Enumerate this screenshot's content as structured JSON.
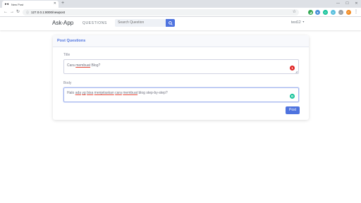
{
  "browser": {
    "tab_title": "New Post",
    "tab_favicon": "▸◂",
    "tab_close": "✕",
    "new_tab": "+",
    "minimize": "—",
    "maximize": "☐",
    "close": "✕",
    "back": "←",
    "forward": "→",
    "reload": "↻",
    "lock": "ⓘ",
    "url": "127.0.0.1:8000/newpost",
    "star": "☆",
    "profile_initial": "F",
    "menu": "⋮",
    "extensions": [
      {
        "icon": "puzzle-green-icon",
        "color": "#34a853",
        "glyph": "◢"
      },
      {
        "icon": "circle-blue-icon",
        "color": "#4a90d9",
        "glyph": "●"
      },
      {
        "icon": "circle-green-icon",
        "color": "#15c39a",
        "glyph": "G"
      },
      {
        "icon": "circle-lightblue-icon",
        "color": "#5bc0de",
        "glyph": "◐"
      },
      {
        "icon": "circle-grey-icon",
        "color": "#9aa0a6",
        "glyph": "○"
      }
    ]
  },
  "navbar": {
    "brand": "Ask-App",
    "questions_link": "QUESTIONS",
    "search_placeholder": "Search Question",
    "search_icon": "🔍",
    "user": "test12",
    "user_caret": "▼"
  },
  "form": {
    "header": "Post Questions",
    "title_label": "Title",
    "title_value_parts": [
      "Cara ",
      "membuat",
      " Blog?"
    ],
    "title_badge": "1",
    "body_label": "Body",
    "body_value_parts": [
      "Halo ",
      "ada",
      " ",
      "yg",
      " ",
      "bisa",
      " ",
      "menjelaskan",
      " ",
      "cara",
      " ",
      "membuat",
      " blog step-by-step?"
    ],
    "body_badge": "G",
    "submit_label": "Post"
  },
  "colors": {
    "primary": "#4e73df",
    "error_badge": "#e02424",
    "grammarly": "#15c39a"
  }
}
